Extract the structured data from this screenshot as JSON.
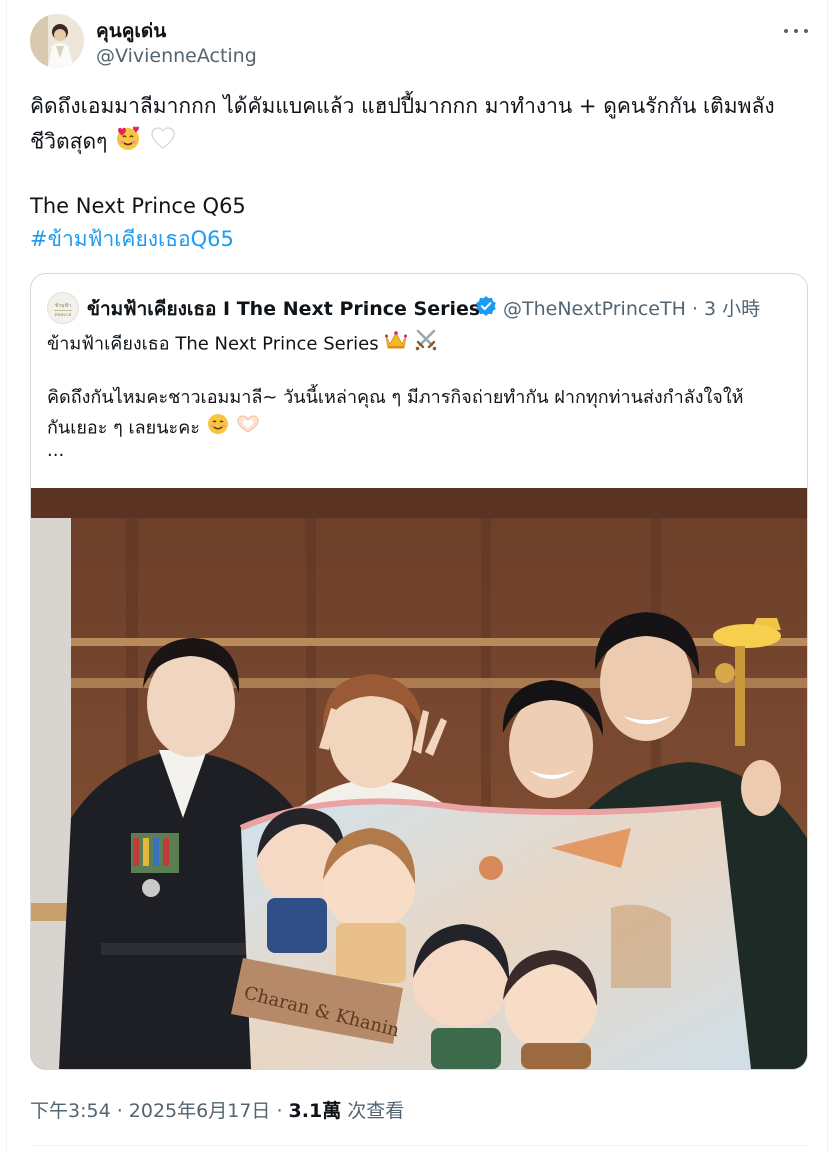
{
  "author": {
    "display_name": "คุนคูเด่น",
    "handle": "@VivienneActing"
  },
  "tweet": {
    "line1": "คิดถึงเอมมาลีมากกก ได้คัมแบคแล้ว แฮปปี้มากกก มาทำงาน + ดูคนรักกัน เติมพลัง",
    "line2": "ชีวิตสุดๆ",
    "line3": "The Next Prince Q65",
    "hashtag": "#ข้ามฟ้าเคียงเธอQ65",
    "emojis_line2": [
      "smiling-face-with-hearts",
      "white-heart"
    ]
  },
  "quoted": {
    "display_name": "ข้ามฟ้าเคียงเธอ I The Next Prince Series",
    "verified": true,
    "handle": "@TheNextPrinceTH",
    "separator": "·",
    "time": "3 小時",
    "line1": "ข้ามฟ้าเคียงเธอ The Next Prince Series",
    "line2": "คิดถึงกันไหมคะชาวเอมมาลี~ วันนี้เหล่าคุณ ๆ มีภารกิจถ่ายทำกัน ฝากทุกท่านส่งกำลังใจให้",
    "line3": "กันเยอะ ๆ เลยนะคะ",
    "ellipsis": "...",
    "image": {
      "banner_text": "Charan & Khanin"
    }
  },
  "meta": {
    "datetime": "下午3:54 · 2025年6月17日 ·",
    "views_count": "3.1萬",
    "views_label": "次查看"
  },
  "colors": {
    "link": "#1d9bf0",
    "text": "#0f1419",
    "secondary": "#536471",
    "border": "#cfd9de"
  }
}
